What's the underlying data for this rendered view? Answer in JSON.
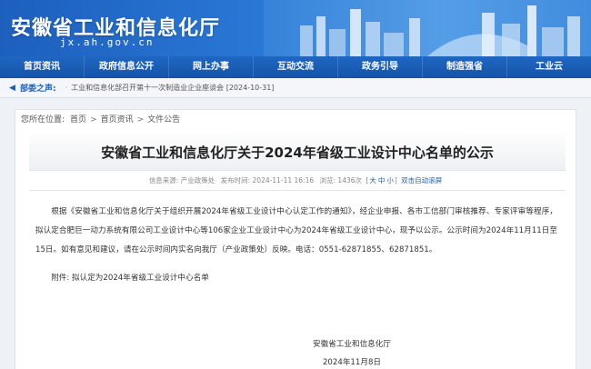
{
  "header": {
    "site_title": "安徽省工业和信息化厅",
    "site_domain": "jx.ah.gov.cn",
    "brand_color": "#1d5fbd"
  },
  "nav": {
    "items": [
      {
        "label": "首页资讯"
      },
      {
        "label": "政府信息公开"
      },
      {
        "label": "网上办事"
      },
      {
        "label": "互动交流"
      },
      {
        "label": "政务引导"
      },
      {
        "label": "制造强省"
      },
      {
        "label": "工业云"
      }
    ]
  },
  "ticker": {
    "label": "部委之声:",
    "dot": "·",
    "text": "工业和信息化部召开第十一次制造业企业座谈会 [2024-10-31]"
  },
  "breadcrumb": {
    "prefix": "您所在位置:",
    "items": [
      "首页",
      "首页资讯",
      "文件公告"
    ],
    "separator": ">"
  },
  "article": {
    "title": "安徽省工业和信息化厅关于2024年省级工业设计中心名单的公示",
    "meta": {
      "source": "信息来源: 产业政策处",
      "date": "发布时间: 2024-11-11 16:16",
      "views": "浏览: 1436次",
      "size_open": "[",
      "size_large": "大",
      "size_medium": "中",
      "size_small": "小",
      "size_close": "]",
      "double_click": "双击自动滚屏"
    },
    "paragraph": "根据《安徽省工业和信息化厅关于组织开展2024年省级工业设计中心认定工作的通知》，经企业申报、各市工信部门审核推荐、专家评审等程序，拟认定合肥巨一动力系统有限公司工业设计中心等106家企业工业设计中心为2024年省级工业设计中心，现予以公示。公示时间为2024年11月11日至15日。如有意见和建议，请在公示时间内实名向我厅（产业政策处）反映。电话：0551-62871855、62871851。",
    "attachment_label": "附件:",
    "attachment_link": "拟认定为2024年省级工业设计中心名单",
    "signature": "安徽省工业和信息化厅",
    "sign_date": "2024年11月8日"
  }
}
